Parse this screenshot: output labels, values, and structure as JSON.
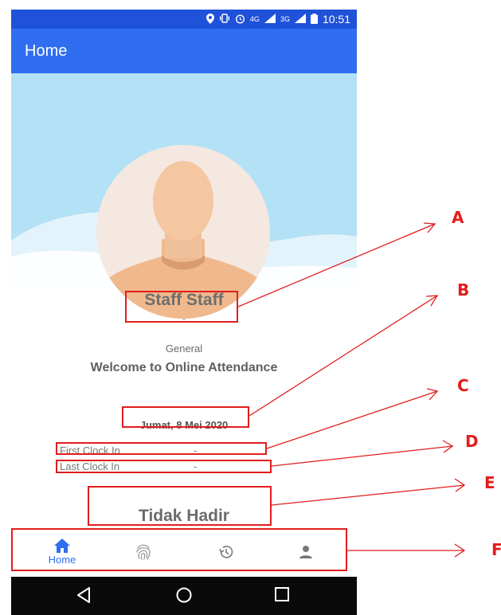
{
  "status_bar": {
    "network_4g": "4G",
    "network_3g": "3G",
    "time": "10:51"
  },
  "app_bar": {
    "title": "Home"
  },
  "profile": {
    "name": "Staff Staff",
    "position": "-",
    "department": "General",
    "welcome": "Welcome to Online Attendance"
  },
  "attendance": {
    "date": "Jumat, 8 Mei 2020",
    "first_clock_in_label": "First Clock In",
    "first_clock_in_value": "-",
    "last_clock_in_label": "Last Clock In",
    "last_clock_in_value": "-",
    "status": "Tidak Hadir"
  },
  "bottom_nav": {
    "items": [
      {
        "label": "Home",
        "icon": "home-icon",
        "active": true
      },
      {
        "label": "",
        "icon": "fingerprint-icon",
        "active": false
      },
      {
        "label": "",
        "icon": "history-icon",
        "active": false
      },
      {
        "label": "",
        "icon": "person-icon",
        "active": false
      }
    ]
  },
  "system_nav": {
    "icons": [
      "back-icon",
      "home-circle-icon",
      "recents-icon"
    ]
  },
  "annotations": {
    "letters": [
      "A",
      "B",
      "C",
      "D",
      "E",
      "F"
    ],
    "color": "#e21d1d"
  },
  "colors": {
    "primary": "#2f6ef0",
    "status_bar": "#1f52d9",
    "hero_sky": "#b3e1f5"
  }
}
